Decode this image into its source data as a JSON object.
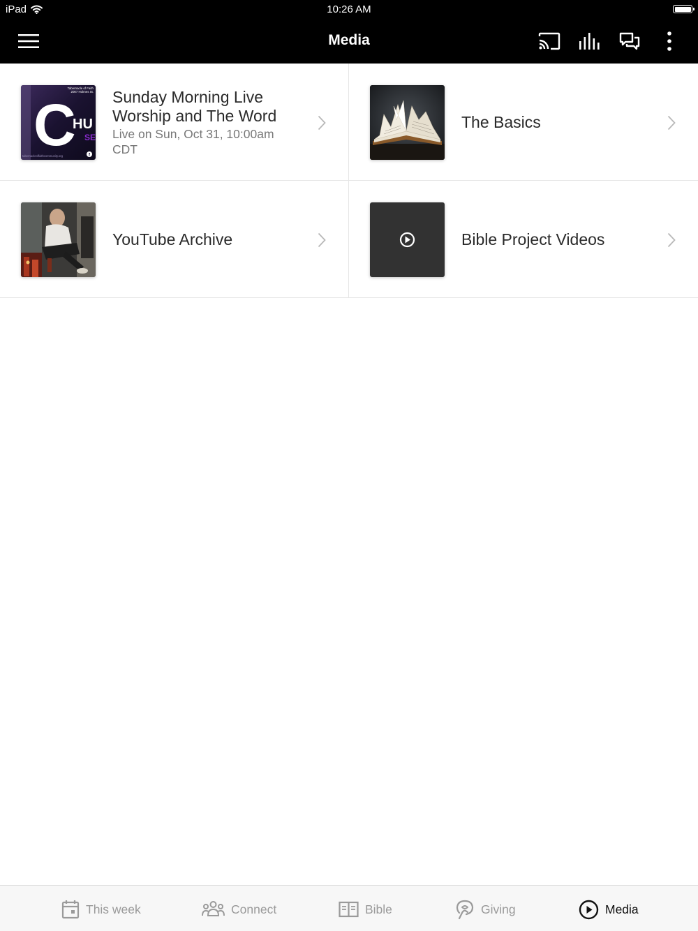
{
  "status_bar": {
    "device": "iPad",
    "time": "10:26 AM"
  },
  "nav": {
    "title": "Media",
    "icons": [
      "menu-icon",
      "cast-icon",
      "audio-bars-icon",
      "chat-icon",
      "more-vertical-icon"
    ]
  },
  "media_items": [
    {
      "title": "Sunday Morning Live Worship and The Word",
      "subtitle": "Live on Sun, Oct 31, 10:00am CDT",
      "thumb_text": {
        "org_line1": "Tabernacle of Faith",
        "org_line2": "2007 Holmes St.",
        "big_letter": "C",
        "word": "HU",
        "sub": "SE",
        "url": "tabernacleoffaithcommunity.org"
      }
    },
    {
      "title": "The Basics",
      "subtitle": ""
    },
    {
      "title": "YouTube Archive",
      "subtitle": ""
    },
    {
      "title": "Bible Project Videos",
      "subtitle": ""
    }
  ],
  "tabs": [
    {
      "label": "This week",
      "icon": "calendar-icon",
      "active": false
    },
    {
      "label": "Connect",
      "icon": "people-icon",
      "active": false
    },
    {
      "label": "Bible",
      "icon": "book-icon",
      "active": false
    },
    {
      "label": "Giving",
      "icon": "giving-icon",
      "active": false
    },
    {
      "label": "Media",
      "icon": "play-circle-icon",
      "active": true
    }
  ],
  "colors": {
    "bar_background": "#000000",
    "tab_inactive": "#9a9a9a",
    "tab_active": "#111111",
    "divider": "#e6e6e6"
  }
}
